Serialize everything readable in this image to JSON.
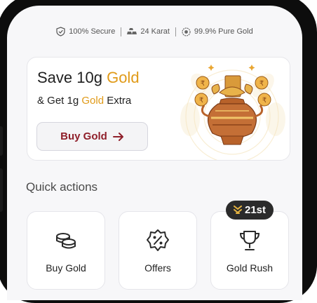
{
  "trust_bar": {
    "items": [
      {
        "icon": "shield-check-icon",
        "label": "100% Secure"
      },
      {
        "icon": "gold-bars-icon",
        "label": "24 Karat"
      },
      {
        "icon": "seal-badge-icon",
        "label": "99.9% Pure Gold"
      }
    ]
  },
  "promo": {
    "title_prefix": "Save 10g ",
    "title_highlight": "Gold",
    "subtitle_prefix": "& Get 1g ",
    "subtitle_highlight": "Gold",
    "subtitle_suffix": " Extra",
    "button_label": "Buy Gold",
    "button_icon": "arrow-right-icon",
    "illustration": "gold-kalash-pot-with-coins"
  },
  "quick_actions": {
    "title": "Quick actions",
    "items": [
      {
        "label": "Buy Gold",
        "icon": "coins-stack-icon"
      },
      {
        "label": "Offers",
        "icon": "discount-badge-icon"
      },
      {
        "label": "Gold Rush",
        "icon": "trophy-icon",
        "badge": "21st",
        "badge_icon": "rank-chevron-icon"
      }
    ]
  },
  "colors": {
    "gold_accent": "#e09a18",
    "button_text": "#8f1f2a",
    "badge_bg": "#2b2b2b"
  }
}
